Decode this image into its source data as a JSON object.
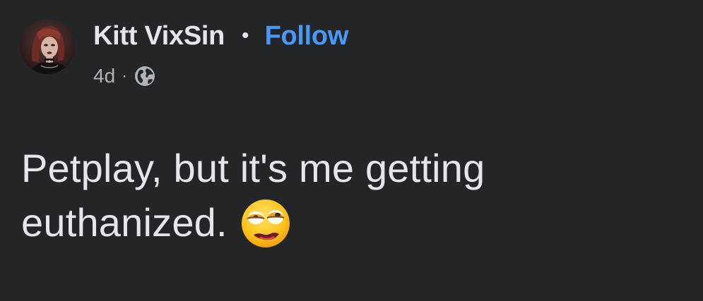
{
  "post": {
    "author": "Kitt VixSin",
    "separator": "•",
    "follow_label": "Follow",
    "timestamp": "4d",
    "meta_separator": "·",
    "privacy_icon": "globe-icon",
    "text": "Petplay, but it's me getting euthanized.",
    "emoji_icon": "face-with-rolling-eyes-icon"
  },
  "colors": {
    "background": "#242526",
    "primary_text": "#e4e6eb",
    "secondary_text": "#b0b3b8",
    "link": "#4599ff"
  }
}
